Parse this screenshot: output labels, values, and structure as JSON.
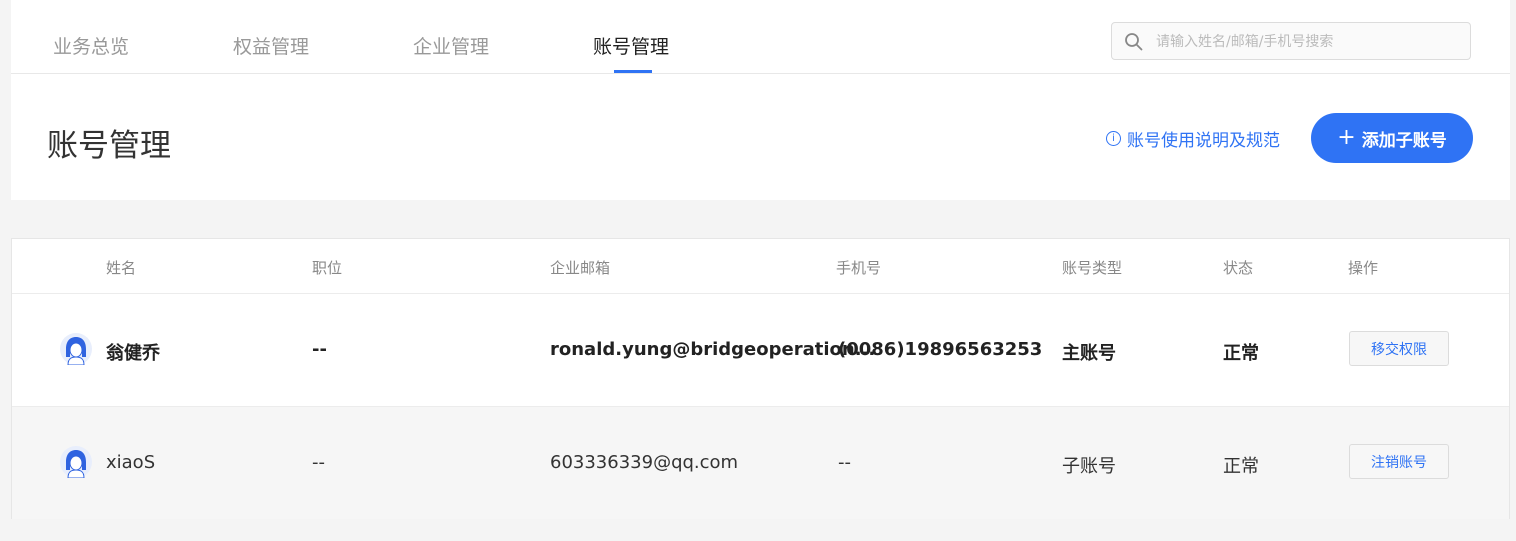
{
  "nav": {
    "tabs": [
      {
        "label": "业务总览"
      },
      {
        "label": "权益管理"
      },
      {
        "label": "企业管理"
      },
      {
        "label": "账号管理"
      }
    ],
    "active_tab": "账号管理",
    "search_placeholder": "请输入姓名/邮箱/手机号搜索"
  },
  "header": {
    "title": "账号管理",
    "guide_link": "账号使用说明及规范",
    "add_button": "添加子账号"
  },
  "table": {
    "columns": [
      "姓名",
      "职位",
      "企业邮箱",
      "手机号",
      "账号类型",
      "状态",
      "操作"
    ],
    "rows": [
      {
        "name": "翁健乔",
        "position": "--",
        "email": "ronald.yung@bridgeoperation...",
        "phone": "(0086)19896563253",
        "account_type": "主账号",
        "status": "正常",
        "action": "移交权限"
      },
      {
        "name": "xiaoS",
        "position": "--",
        "email": "603336339@qq.com",
        "phone": "--",
        "account_type": "子账号",
        "status": "正常",
        "action": "注销账号"
      }
    ]
  },
  "colors": {
    "accent": "#2f73f4",
    "background": "#f4f4f4"
  }
}
